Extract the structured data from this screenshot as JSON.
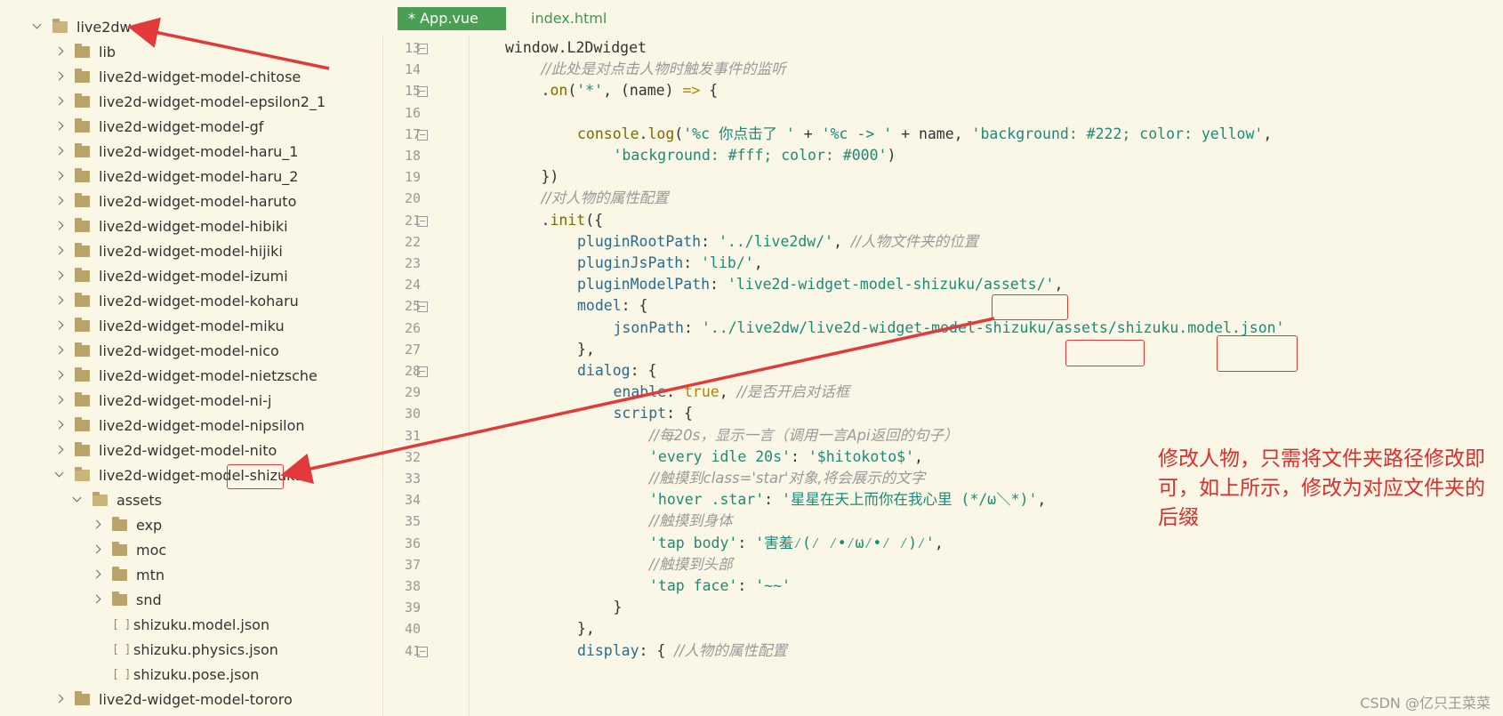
{
  "tree": {
    "root": "live2dw",
    "items": [
      {
        "label": "lib",
        "level": 1,
        "type": "folder",
        "open": false
      },
      {
        "label": "live2d-widget-model-chitose",
        "level": 1,
        "type": "folder",
        "open": false
      },
      {
        "label": "live2d-widget-model-epsilon2_1",
        "level": 1,
        "type": "folder",
        "open": false
      },
      {
        "label": "live2d-widget-model-gf",
        "level": 1,
        "type": "folder",
        "open": false
      },
      {
        "label": "live2d-widget-model-haru_1",
        "level": 1,
        "type": "folder",
        "open": false
      },
      {
        "label": "live2d-widget-model-haru_2",
        "level": 1,
        "type": "folder",
        "open": false
      },
      {
        "label": "live2d-widget-model-haruto",
        "level": 1,
        "type": "folder",
        "open": false
      },
      {
        "label": "live2d-widget-model-hibiki",
        "level": 1,
        "type": "folder",
        "open": false
      },
      {
        "label": "live2d-widget-model-hijiki",
        "level": 1,
        "type": "folder",
        "open": false
      },
      {
        "label": "live2d-widget-model-izumi",
        "level": 1,
        "type": "folder",
        "open": false
      },
      {
        "label": "live2d-widget-model-koharu",
        "level": 1,
        "type": "folder",
        "open": false
      },
      {
        "label": "live2d-widget-model-miku",
        "level": 1,
        "type": "folder",
        "open": false
      },
      {
        "label": "live2d-widget-model-nico",
        "level": 1,
        "type": "folder",
        "open": false
      },
      {
        "label": "live2d-widget-model-nietzsche",
        "level": 1,
        "type": "folder",
        "open": false
      },
      {
        "label": "live2d-widget-model-ni-j",
        "level": 1,
        "type": "folder",
        "open": false
      },
      {
        "label": "live2d-widget-model-nipsilon",
        "level": 1,
        "type": "folder",
        "open": false
      },
      {
        "label": "live2d-widget-model-nito",
        "level": 1,
        "type": "folder",
        "open": false
      },
      {
        "label": "live2d-widget-model-shizuku",
        "level": 1,
        "type": "folder",
        "open": true
      },
      {
        "label": "assets",
        "level": 2,
        "type": "folder",
        "open": true
      },
      {
        "label": "exp",
        "level": 3,
        "type": "folder",
        "open": false
      },
      {
        "label": "moc",
        "level": 3,
        "type": "folder",
        "open": false
      },
      {
        "label": "mtn",
        "level": 3,
        "type": "folder",
        "open": false
      },
      {
        "label": "snd",
        "level": 3,
        "type": "folder",
        "open": false
      },
      {
        "label": "shizuku.model.json",
        "level": 3,
        "type": "file"
      },
      {
        "label": "shizuku.physics.json",
        "level": 3,
        "type": "file"
      },
      {
        "label": "shizuku.pose.json",
        "level": 3,
        "type": "file"
      },
      {
        "label": "live2d-widget-model-tororo",
        "level": 1,
        "type": "folder",
        "open": false
      }
    ]
  },
  "tabs": [
    {
      "label": "* App.vue",
      "active": true
    },
    {
      "label": "index.html",
      "active": false
    }
  ],
  "editor": {
    "line_numbers": [
      "13",
      "14",
      "15",
      "16",
      "17",
      "18",
      "19",
      "20",
      "21",
      "22",
      "23",
      "24",
      "25",
      "26",
      "27",
      "28",
      "29",
      "30",
      "31",
      "32",
      "33",
      "34",
      "35",
      "36",
      "37",
      "38",
      "39",
      "40",
      "41"
    ],
    "fold_lines": [
      "13",
      "15",
      "17",
      "21",
      "25",
      "28",
      "41"
    ],
    "lines": [
      {
        "n": "13",
        "indent": 2,
        "segs": [
          [
            "",
            "window.L2Dwidget"
          ]
        ]
      },
      {
        "n": "14",
        "indent": 3,
        "segs": [
          [
            "cm",
            "//此处是对点击人物时触发事件的监听"
          ]
        ]
      },
      {
        "n": "15",
        "indent": 3,
        "segs": [
          [
            "",
            "."
          ],
          [
            "fn",
            "on"
          ],
          [
            "",
            "("
          ],
          [
            "st",
            "'*'"
          ],
          [
            "",
            ", (name) "
          ],
          [
            "kw",
            "=>"
          ],
          [
            "",
            " {"
          ]
        ]
      },
      {
        "n": "16",
        "indent": 0,
        "segs": []
      },
      {
        "n": "17",
        "indent": 4,
        "segs": [
          [
            "fn",
            "console"
          ],
          [
            "",
            "."
          ],
          [
            "fn",
            "log"
          ],
          [
            "",
            "("
          ],
          [
            "st",
            "'%c 你点击了 '"
          ],
          [
            "",
            " + "
          ],
          [
            "st",
            "'%c -> '"
          ],
          [
            "",
            " + name, "
          ],
          [
            "st",
            "'background: #222; color: yellow'"
          ],
          [
            "",
            ","
          ]
        ]
      },
      {
        "n": "18",
        "indent": 5,
        "segs": [
          [
            "st",
            "'background: #fff; color: #000'"
          ],
          [
            "",
            ")"
          ]
        ]
      },
      {
        "n": "19",
        "indent": 3,
        "segs": [
          [
            "",
            "})"
          ]
        ]
      },
      {
        "n": "20",
        "indent": 3,
        "segs": [
          [
            "cm",
            "//对人物的属性配置"
          ]
        ]
      },
      {
        "n": "21",
        "indent": 3,
        "segs": [
          [
            "",
            "."
          ],
          [
            "fn",
            "init"
          ],
          [
            "",
            "({"
          ]
        ]
      },
      {
        "n": "22",
        "indent": 4,
        "segs": [
          [
            "pr",
            "pluginRootPath"
          ],
          [
            "",
            ": "
          ],
          [
            "st",
            "'../live2dw/'"
          ],
          [
            "",
            ", "
          ],
          [
            "cm",
            "//人物文件夹的位置"
          ]
        ]
      },
      {
        "n": "23",
        "indent": 4,
        "segs": [
          [
            "pr",
            "pluginJsPath"
          ],
          [
            "",
            ": "
          ],
          [
            "st",
            "'lib/'"
          ],
          [
            "",
            ","
          ]
        ]
      },
      {
        "n": "24",
        "indent": 4,
        "segs": [
          [
            "pr",
            "pluginModelPath"
          ],
          [
            "",
            ": "
          ],
          [
            "st",
            "'live2d-widget-model-shizuku/assets/'"
          ],
          [
            "",
            ","
          ]
        ]
      },
      {
        "n": "25",
        "indent": 4,
        "segs": [
          [
            "pr",
            "model"
          ],
          [
            "",
            ": {"
          ]
        ]
      },
      {
        "n": "26",
        "indent": 5,
        "segs": [
          [
            "pr",
            "jsonPath"
          ],
          [
            "",
            ": "
          ],
          [
            "st",
            "'../live2dw/live2d-widget-model-shizuku/assets/shizuku.model.json'"
          ]
        ]
      },
      {
        "n": "27",
        "indent": 4,
        "segs": [
          [
            "",
            "},"
          ]
        ]
      },
      {
        "n": "28",
        "indent": 4,
        "segs": [
          [
            "pr",
            "dialog"
          ],
          [
            "",
            ": {"
          ]
        ]
      },
      {
        "n": "29",
        "indent": 5,
        "segs": [
          [
            "pr",
            "enable"
          ],
          [
            "",
            ": "
          ],
          [
            "kw",
            "true"
          ],
          [
            "",
            ", "
          ],
          [
            "cm",
            "//是否开启对话框"
          ]
        ]
      },
      {
        "n": "30",
        "indent": 5,
        "segs": [
          [
            "pr",
            "script"
          ],
          [
            "",
            ": {"
          ]
        ]
      },
      {
        "n": "31",
        "indent": 6,
        "segs": [
          [
            "cm",
            "//每20s，显示一言（调用一言Api返回的句子）"
          ]
        ]
      },
      {
        "n": "32",
        "indent": 6,
        "segs": [
          [
            "st",
            "'every idle 20s'"
          ],
          [
            "",
            ": "
          ],
          [
            "st",
            "'$hitokoto$'"
          ],
          [
            "",
            ","
          ]
        ]
      },
      {
        "n": "33",
        "indent": 6,
        "segs": [
          [
            "cm",
            "//触摸到class='star'对象,将会展示的文字"
          ]
        ]
      },
      {
        "n": "34",
        "indent": 6,
        "segs": [
          [
            "st",
            "'hover .star'"
          ],
          [
            "",
            ": "
          ],
          [
            "st",
            "'星星在天上而你在我心里 (*/ω＼*)'"
          ],
          [
            "",
            ","
          ]
        ]
      },
      {
        "n": "35",
        "indent": 6,
        "segs": [
          [
            "cm",
            "//触摸到身体"
          ]
        ]
      },
      {
        "n": "36",
        "indent": 6,
        "segs": [
          [
            "st",
            "'tap body'"
          ],
          [
            "",
            ": "
          ],
          [
            "st",
            "'害羞⁄(⁄ ⁄•⁄ω⁄•⁄ ⁄)⁄'"
          ],
          [
            "",
            ","
          ]
        ]
      },
      {
        "n": "37",
        "indent": 6,
        "segs": [
          [
            "cm",
            "//触摸到头部"
          ]
        ]
      },
      {
        "n": "38",
        "indent": 6,
        "segs": [
          [
            "st",
            "'tap face'"
          ],
          [
            "",
            ": "
          ],
          [
            "st",
            "'~~'"
          ]
        ]
      },
      {
        "n": "39",
        "indent": 5,
        "segs": [
          [
            "",
            "}"
          ]
        ]
      },
      {
        "n": "40",
        "indent": 4,
        "segs": [
          [
            "",
            "},"
          ]
        ]
      },
      {
        "n": "41",
        "indent": 4,
        "segs": [
          [
            "pr",
            "display"
          ],
          [
            "",
            ": { "
          ],
          [
            "cm",
            "//人物的属性配置"
          ]
        ]
      }
    ]
  },
  "annotation": {
    "note": "修改人物，只需将文件夹路径修改即可，如上所示，修改为对应文件夹的后缀",
    "color": "#e23a3a"
  },
  "watermark": "CSDN @亿只王菜菜"
}
